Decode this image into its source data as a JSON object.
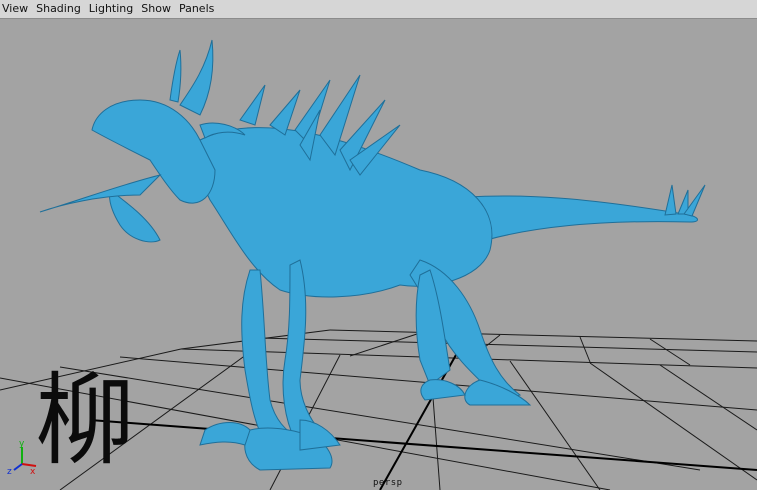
{
  "menubar": {
    "items": [
      "View",
      "Shading",
      "Lighting",
      "Show",
      "Panels"
    ]
  },
  "viewport": {
    "camera": "persp",
    "model_color": "#3aa6d8",
    "grid_color": "#1a1a1a",
    "background": "#a3a3a3",
    "watermark_text": "柳"
  },
  "axis_gizmo": {
    "x_label": "x",
    "y_label": "y",
    "z_label": "z",
    "x_color": "#d01010",
    "y_color": "#10b010",
    "z_color": "#1030d0"
  }
}
